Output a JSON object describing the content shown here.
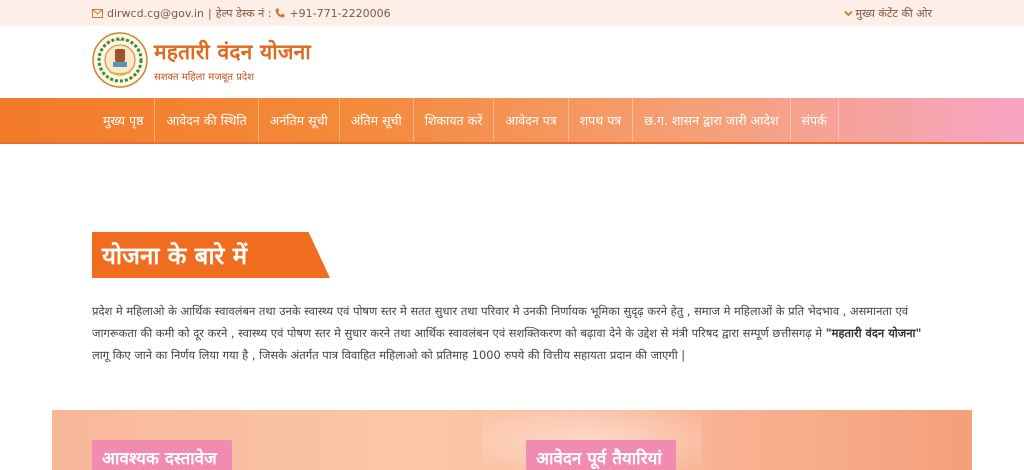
{
  "topbar": {
    "email": "dirwcd.cg@gov.in",
    "separator": "|",
    "helpdesk_label": "हेल्प डेस्क नं :",
    "phone": "+91-771-2220006",
    "main_content_link": "मुख्य कंटेंट की ओर",
    "icons": {
      "email": "envelope-icon",
      "phone": "phone-icon",
      "skip": "chevron-down-icon"
    }
  },
  "header": {
    "title": "महतारी वंदन योजना",
    "subtitle": "सशक्त महिला मजबूत प्रदेश",
    "logo": "chhattisgarh-emblem"
  },
  "nav": {
    "items": [
      "मुख्य पृष्ठ",
      "आवेदन की स्थिति",
      "अनंतिम सूची",
      "अंतिम सूची",
      "शिकायत करें",
      "आवेदन पत्र",
      "शपथ पत्र",
      "छ.ग. शासन द्वारा जारी आदेश",
      "संपर्क"
    ]
  },
  "about": {
    "heading": "योजना के बारे में",
    "text_before": "प्रदेश मे महिलाओ के आर्थिक स्वावलंबन तथा उनके स्वास्थ्य एवं पोषण स्तर मे सतत सुधार तथा परिवार मे उनकी निर्णायक भूमिका सुदृढ़ करने हेतु , समाज मे महिलाओं के प्रति भेदभाव , असमानता एवं जागरूकता की कमी को दूर करने , स्वास्थ्य एवं पोषण स्तर मे सुधार करने तथा आर्थिक स्वावलंबन एवं सशक्तिकरण को बढ़ावा देने के उद्देश से मंत्री परिषद द्वारा सम्पूर्ण छत्तीसगढ़ मे ",
    "scheme_name": "\"महतारी वंदन योजना\"",
    "text_after": " लागू किए जाने का निर्णय लिया गया है , जिसके अंतर्गत पात्र विवाहित महिलाओ को प्रतिमाह 1000 रुपये की वित्तीय सहायता प्रदान की जाएगी |"
  },
  "bottom": {
    "left_heading": "आवश्यक दस्तावेज",
    "right_heading": "आवेदन पूर्व तैयारियां",
    "colors": {
      "heading_bg": "#f28bb0",
      "section_bg": "#fbc7a9"
    }
  },
  "colors": {
    "accent": "#f06d1f",
    "nav_start": "#f37b2a",
    "nav_end": "#f7a5c5"
  }
}
